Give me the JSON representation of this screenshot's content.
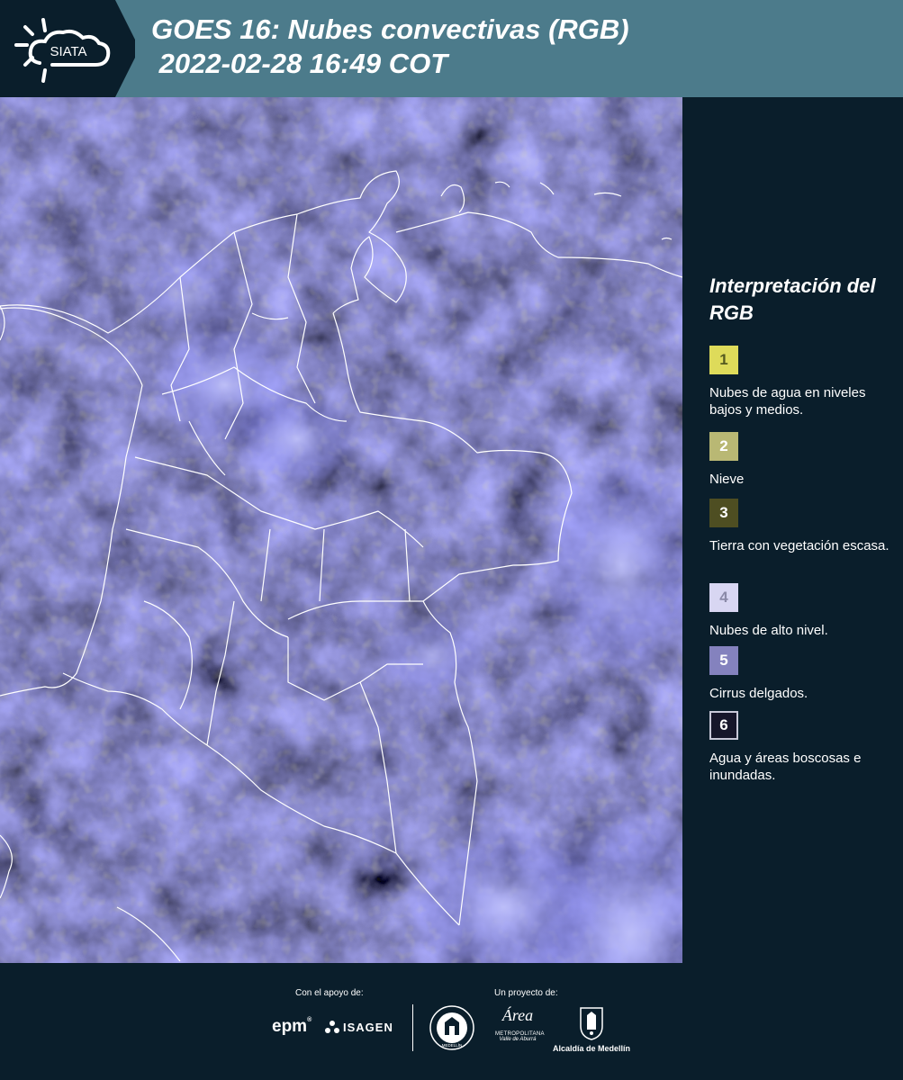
{
  "header": {
    "logo_text": "SIATA",
    "title_line1": "GOES 16: Nubes convectivas (RGB)",
    "title_line2": " 2022-02-28 16:49 COT"
  },
  "legend": {
    "title": "Interpretación del RGB",
    "items": [
      {
        "num": "1",
        "label": "Nubes de agua en niveles bajos y medios.",
        "color": "#dedb5a",
        "numcolor": "#555a20",
        "border": "#dedb5a"
      },
      {
        "num": "2",
        "label": "Nieve",
        "color": "#b9b874",
        "numcolor": "#ffffff",
        "border": "#b9b874"
      },
      {
        "num": "3",
        "label": "Tierra con vegetación escasa.",
        "color": "#4e4e22",
        "numcolor": "#ffffff",
        "border": "#4e4e22"
      },
      {
        "num": "4",
        "label": "Nubes de alto nivel.",
        "color": "#d8d6f2",
        "numcolor": "#8b8aa8",
        "border": "#d8d6f2"
      },
      {
        "num": "5",
        "label": "Cirrus delgados.",
        "color": "#8482be",
        "numcolor": "#ffffff",
        "border": "#8482be"
      },
      {
        "num": "6",
        "label": "Agua y áreas boscosas e inundadas.",
        "color": "#16162a",
        "numcolor": "#ffffff",
        "border": "#c8c8d8"
      }
    ]
  },
  "footer": {
    "support_label": "Con el apoyo de:",
    "project_label": "Un proyecto de:",
    "epm": "epm",
    "isagen": "ISAGEN",
    "seal_text": "MEDELLÍN",
    "area_script": "Área",
    "area_line1": "METROPOLITANA",
    "area_line2": "Valle de Aburrá",
    "alcaldia": "Alcaldía de Medellín"
  }
}
